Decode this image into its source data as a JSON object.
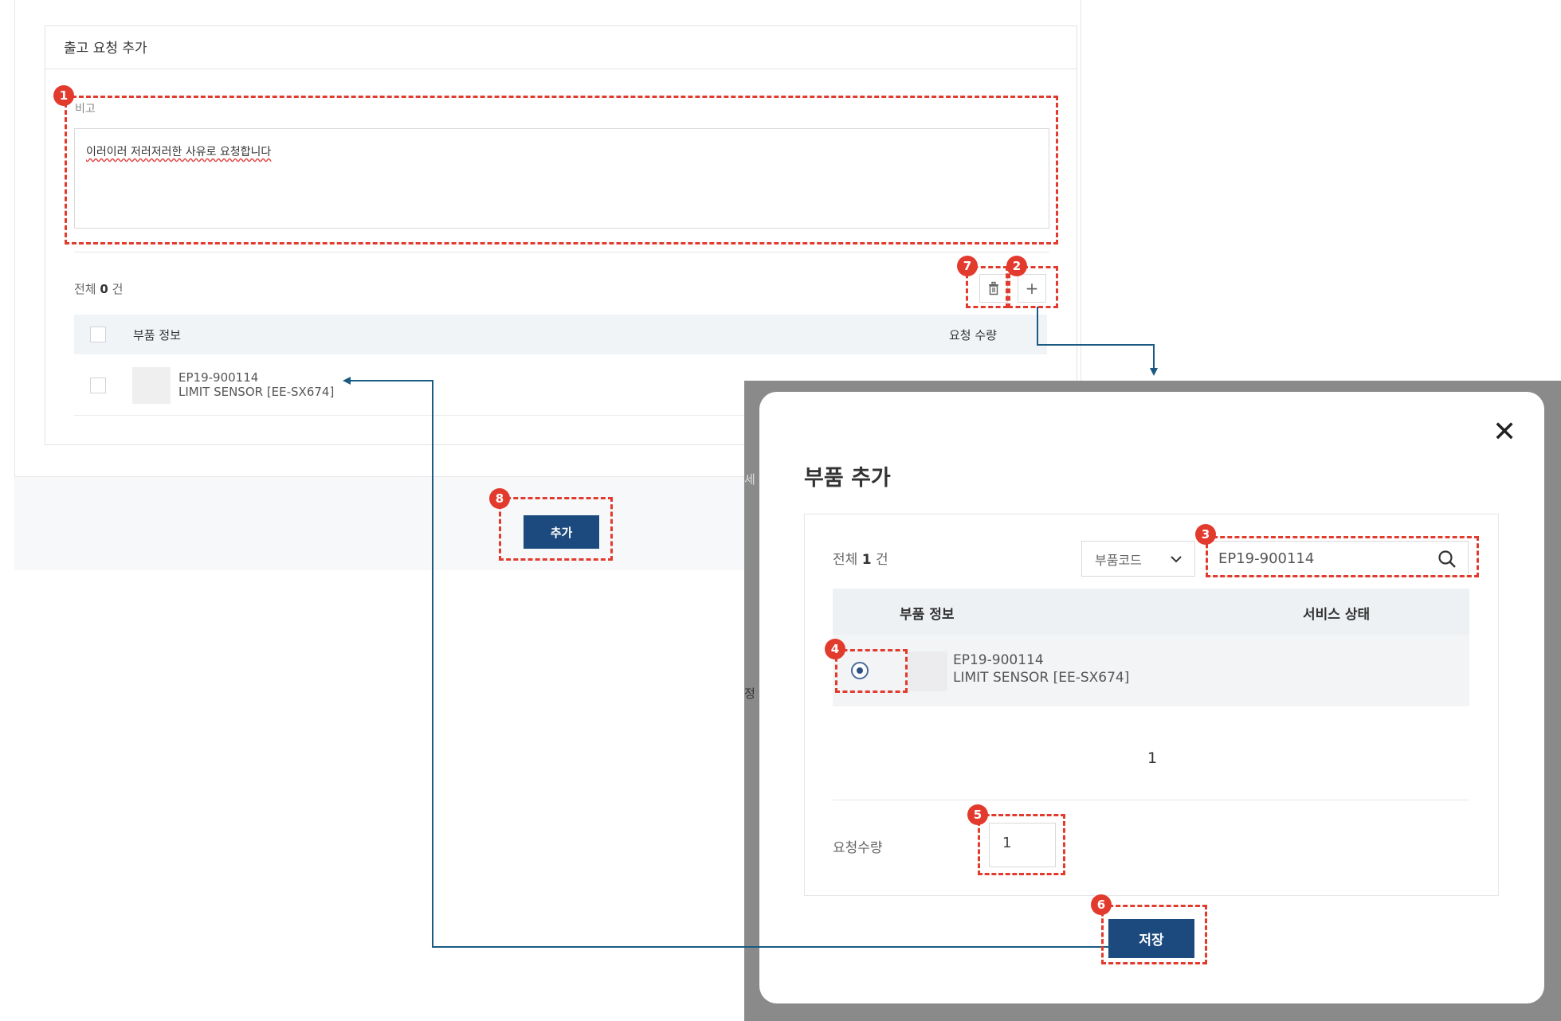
{
  "main": {
    "card_title": "출고 요청 추가",
    "memo_label": "비고",
    "memo_value": "이러이러 저러저러한 사유로 요청합니다",
    "count_prefix": "전체",
    "count_value": "0",
    "count_suffix": "건",
    "delete_icon": "trash-icon",
    "add_icon": "plus-icon",
    "add_symbol": "+",
    "table": {
      "columns": [
        "부품 정보",
        "요청 수량"
      ],
      "rows": [
        {
          "code": "EP19-900114",
          "name": "LIMIT SENSOR [EE-SX674]"
        }
      ]
    },
    "submit_label": "추가"
  },
  "modal": {
    "title": "부품 추가",
    "close_symbol": "✕",
    "count_prefix": "전체",
    "count_value": "1",
    "count_suffix": "건",
    "search_type_selected": "부품코드",
    "search_value": "EP19-900114",
    "table": {
      "columns": [
        "부품 정보",
        "서비스 상태"
      ],
      "rows": [
        {
          "code": "EP19-900114",
          "name": "LIMIT SENSOR [EE-SX674]",
          "selected": true
        }
      ]
    },
    "page": "1",
    "qty_label": "요청수량",
    "qty_value": "1",
    "save_label": "저장"
  },
  "behind_modal_fragments": [
    "세",
    "정"
  ],
  "annotations": [
    "1",
    "2",
    "3",
    "4",
    "5",
    "6",
    "7",
    "8"
  ],
  "colors": {
    "primary": "#1c4a7e",
    "annotation_red": "#e23b2e",
    "connector": "#1a5a82"
  }
}
